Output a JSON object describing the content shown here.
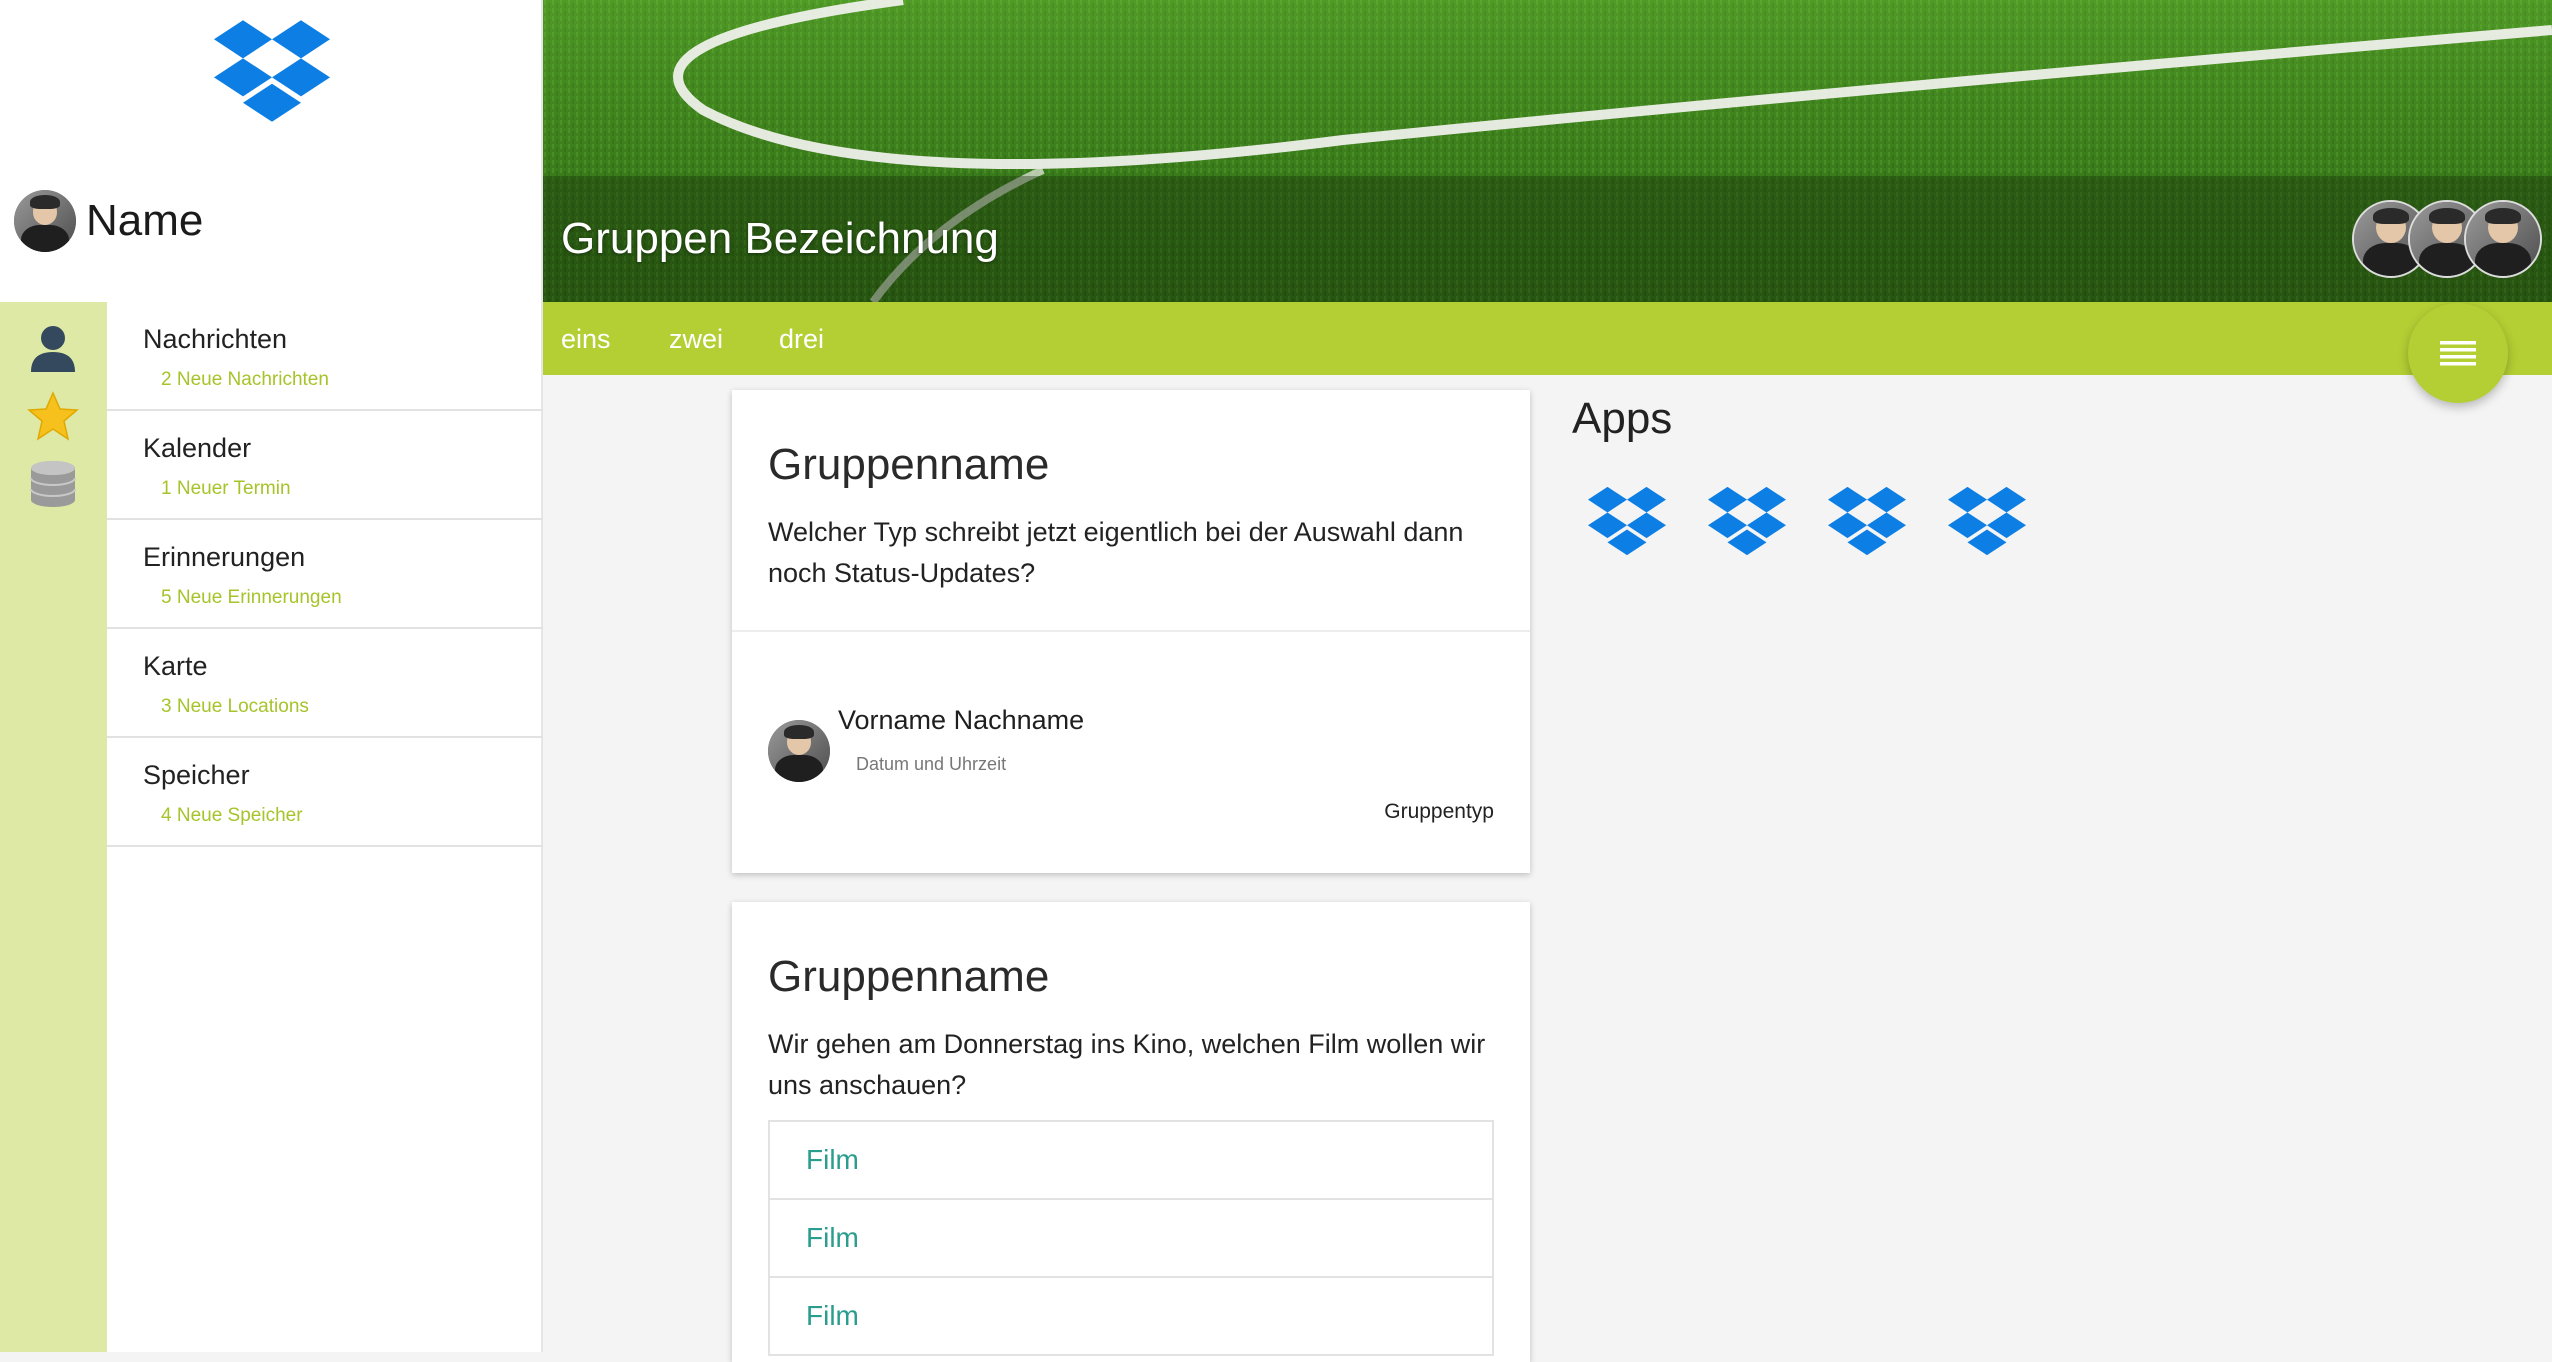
{
  "brand": {
    "logo_icon": "dropbox-icon",
    "accent": "#0d7ee3"
  },
  "user": {
    "name": "Name"
  },
  "rail_icons": [
    "person-icon",
    "star-icon",
    "database-icon"
  ],
  "menu": {
    "items": [
      {
        "label": "Nachrichten",
        "sub": "2 Neue Nachrichten"
      },
      {
        "label": "Kalender",
        "sub": "1 Neuer Termin"
      },
      {
        "label": "Erinnerungen",
        "sub": "5 Neue Erinnerungen"
      },
      {
        "label": "Karte",
        "sub": "3 Neue Locations"
      },
      {
        "label": "Speicher",
        "sub": "4 Neue Speicher"
      }
    ]
  },
  "hero": {
    "title": "Gruppen Bezeichnung"
  },
  "tabs": [
    "eins",
    "zwei",
    "drei"
  ],
  "colors": {
    "green": "#b4cf34",
    "rail": "#dfe9a6",
    "film": "#2a9d8f"
  },
  "cards": [
    {
      "title": "Gruppenname",
      "text": "Welcher Typ schreibt jetzt eigentlich bei der Auswahl dann noch Status-Updates?",
      "author": "Vorname Nachname",
      "date": "Datum und Uhrzeit",
      "group_type": "Gruppentyp"
    },
    {
      "title": "Gruppenname",
      "text": "Wir gehen am Donnerstag ins Kino, welchen Film wollen wir uns anschauen?",
      "options": [
        "Film",
        "Film",
        "Film"
      ]
    }
  ],
  "apps": {
    "title": "Apps",
    "icons": [
      "dropbox-icon",
      "dropbox-icon",
      "dropbox-icon",
      "dropbox-icon"
    ]
  }
}
